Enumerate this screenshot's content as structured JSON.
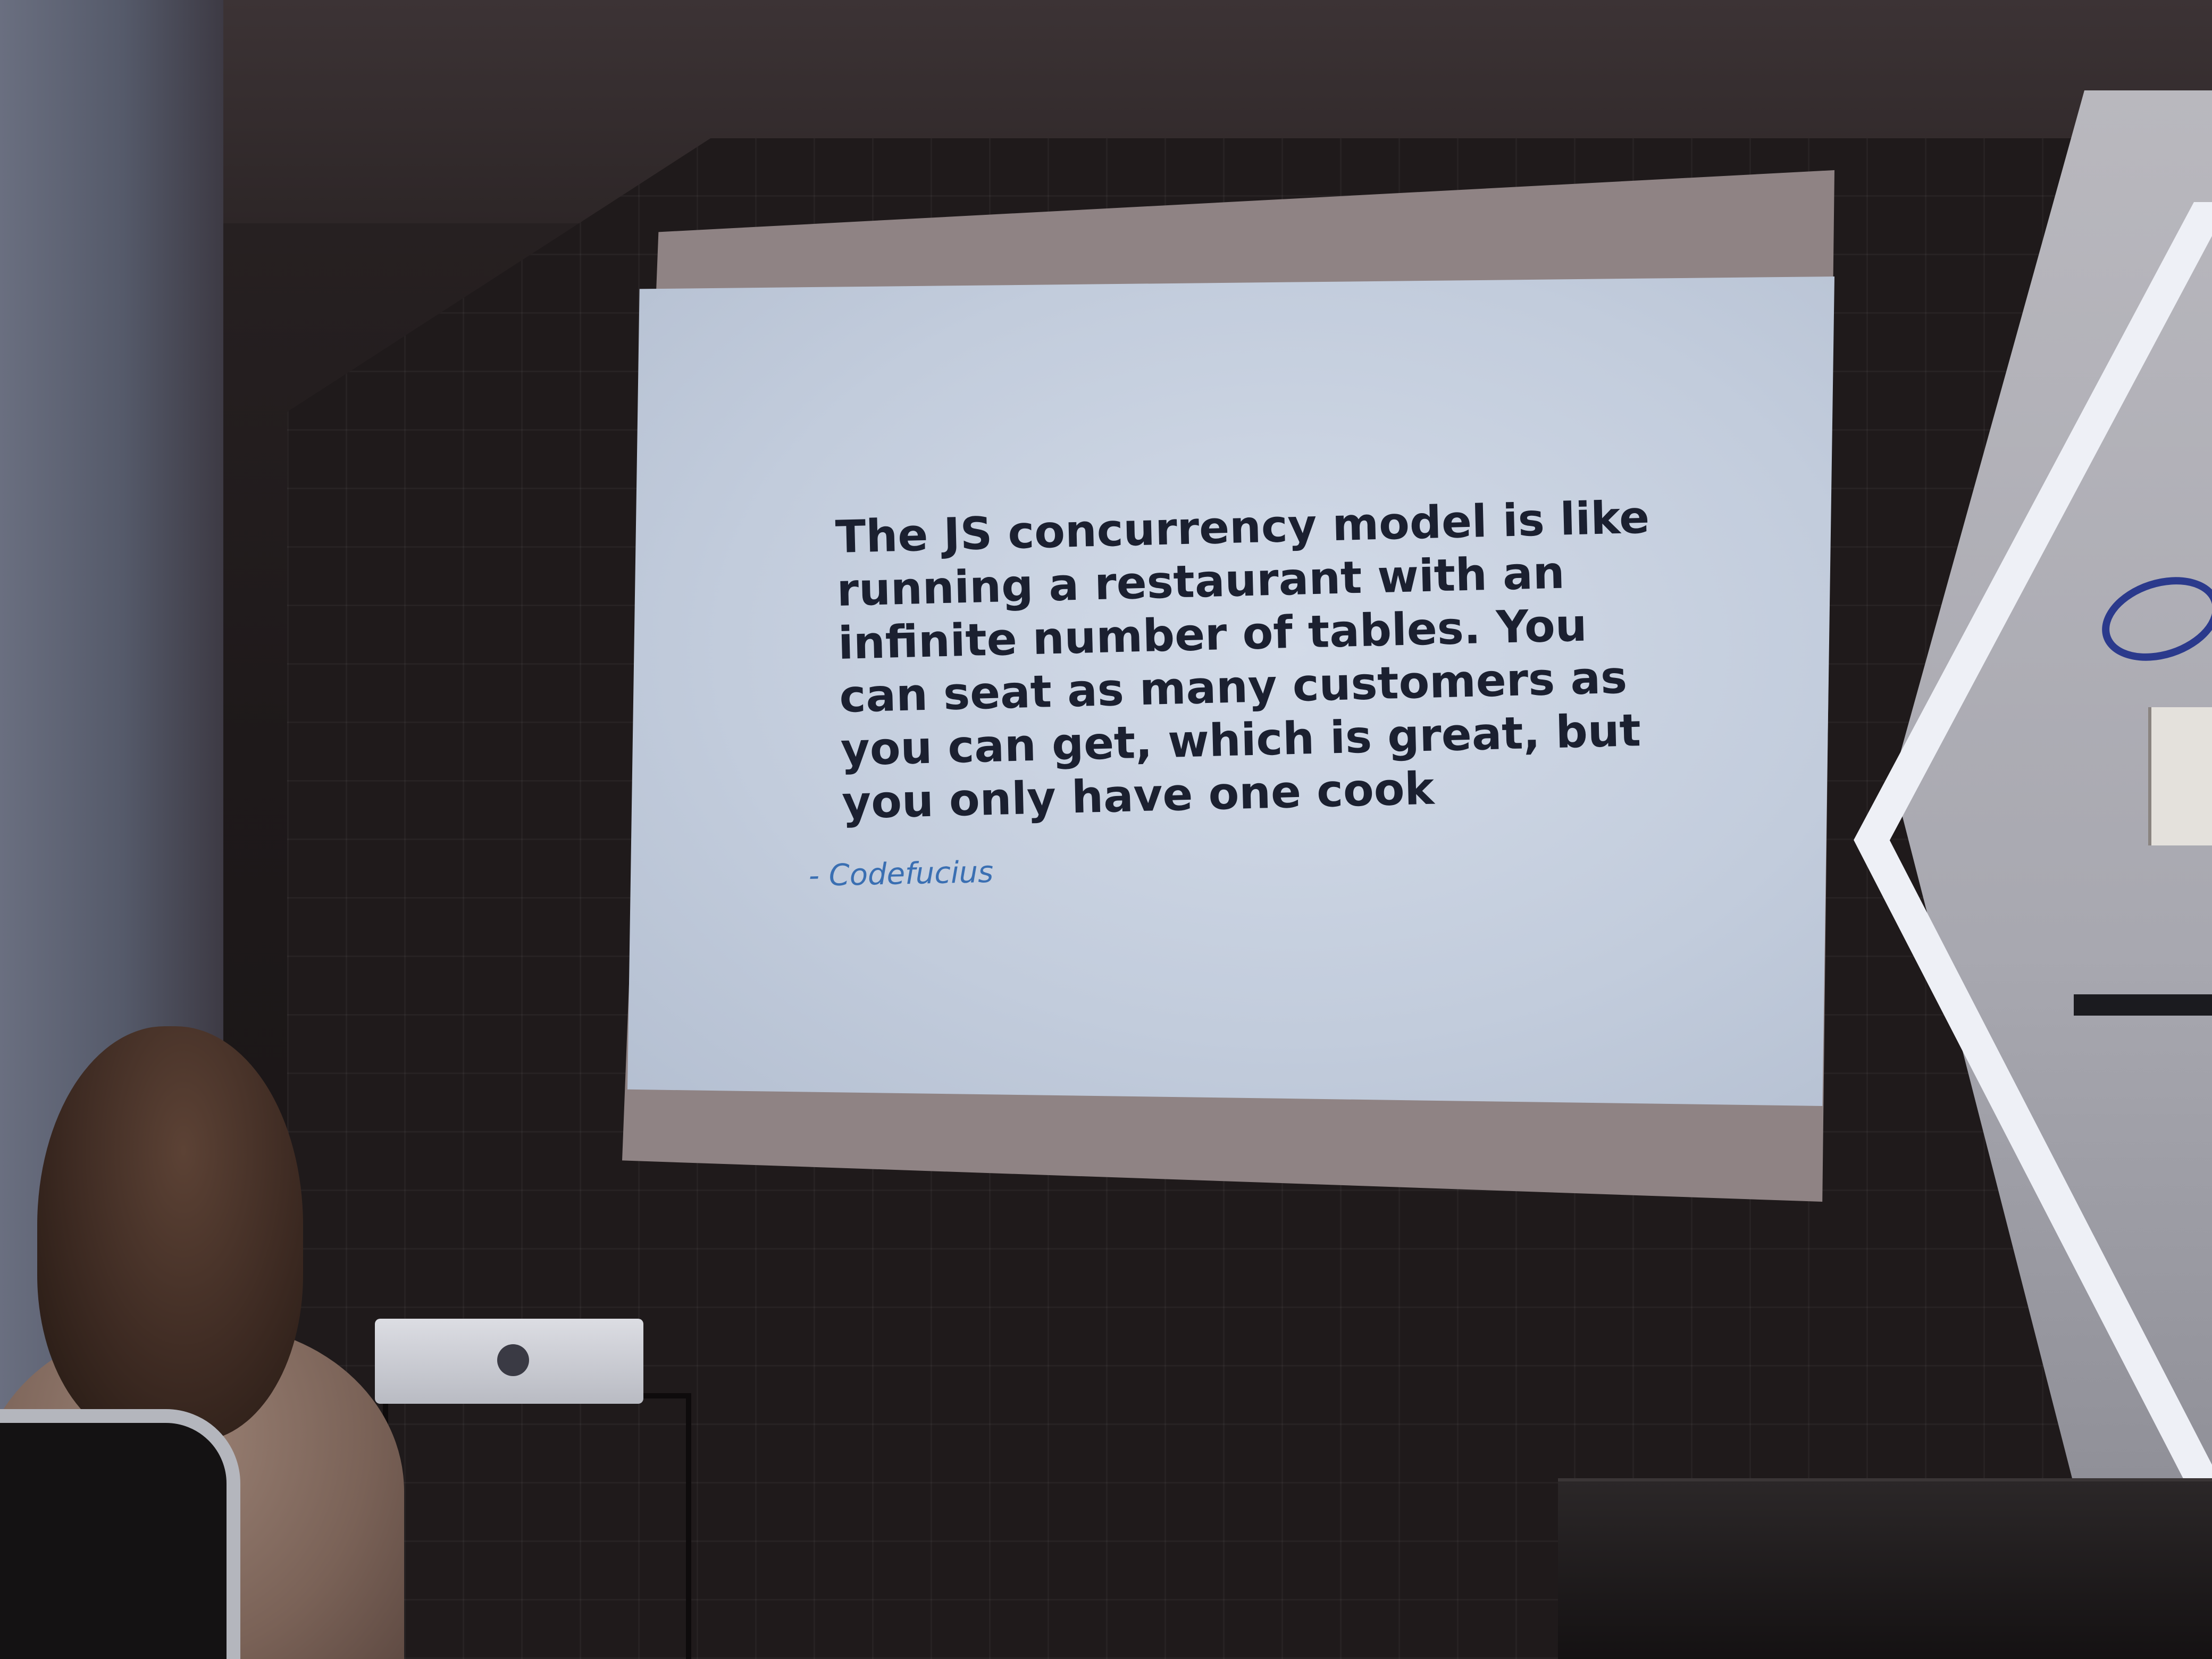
{
  "slide": {
    "quote_lines": [
      "The JS concurrency model is like",
      "running a restaurant with an",
      "infinite number of tables. You",
      "can seat as many customers as",
      "you can get, which is great, but",
      "you only have one cook"
    ],
    "attribution": "- Codefucius"
  },
  "colors": {
    "slide_background": "#c8d1df",
    "quote_text": "#1b2030",
    "attribution_text": "#3a6fb2",
    "room_dark": "#1c1718"
  }
}
